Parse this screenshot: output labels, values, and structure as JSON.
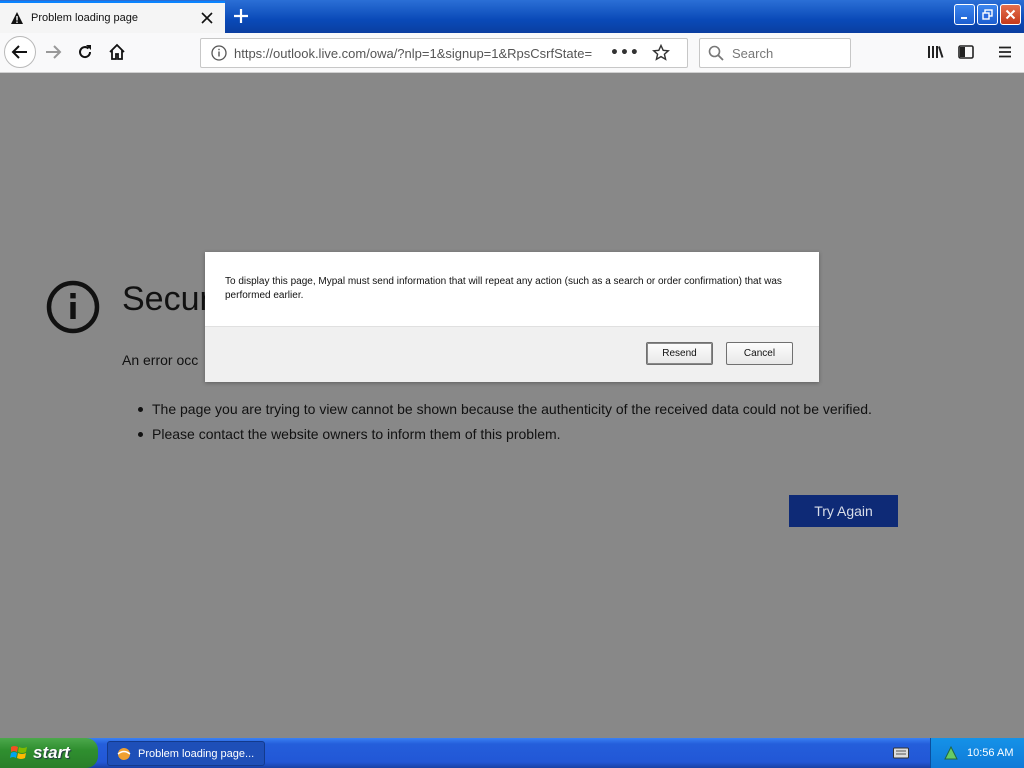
{
  "browser": {
    "tab_title": "Problem loading page",
    "url": "https://outlook.live.com/owa/?nlp=1&signup=1&RpsCsrfState=",
    "url_menu": "•••",
    "search_placeholder": "Search"
  },
  "page": {
    "title_visible": "Secur",
    "description_visible": "An error occ",
    "bullets": [
      "The page you are trying to view cannot be shown because the authenticity of the received data could not be verified.",
      "Please contact the website owners to inform them of this problem."
    ],
    "try_again_label": "Try Again"
  },
  "dialog": {
    "message": "To display this page, Mypal must send information that will repeat any action (such as a search or order confirmation) that was performed earlier.",
    "resend_label": "Resend",
    "cancel_label": "Cancel"
  },
  "taskbar": {
    "start_label": "start",
    "task_label": "Problem loading page...",
    "clock": "10:56 AM"
  },
  "colors": {
    "overlay": "#888888",
    "try_again_bg": "#0e2a76",
    "taskbar_blue": "#245edb",
    "start_green": "#2f8f2f"
  }
}
